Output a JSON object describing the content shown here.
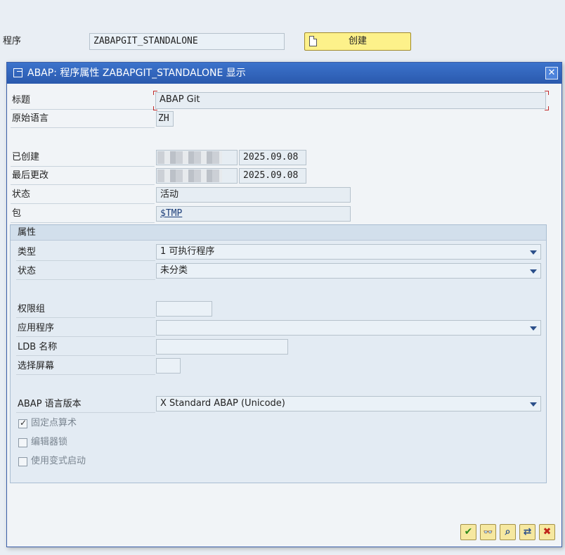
{
  "background": {
    "program_label": "程序",
    "program_value": "ZABAPGIT_STANDALONE",
    "create_button": "创建"
  },
  "dialog": {
    "title": "ABAP: 程序属性 ZABAPGIT_STANDALONE 显示",
    "close_glyph": "✕",
    "fields": {
      "title_label": "标题",
      "title_value": "ABAP Git",
      "orig_lang_label": "原始语言",
      "orig_lang_value": "ZH",
      "created_label": "已创建",
      "created_date": "2025.09.08",
      "changed_label": "最后更改",
      "changed_date": "2025.09.08",
      "status_label": "状态",
      "status_value": "活动",
      "package_label": "包",
      "package_value": "$TMP"
    },
    "attributes": {
      "header": "属性",
      "type_label": "类型",
      "type_value": "1 可执行程序",
      "status_label": "状态",
      "status_value": "未分类",
      "authgroup_label": "权限组",
      "authgroup_value": "",
      "app_label": "应用程序",
      "app_value": "",
      "ldb_label": "LDB 名称",
      "ldb_value": "",
      "selscreen_label": "选择屏幕",
      "selscreen_value": "",
      "abap_version_label": "ABAP 语言版本",
      "abap_version_value": "X Standard ABAP (Unicode)",
      "fixed_point_label": "固定点算术",
      "fixed_point_checked": true,
      "editor_lock_label": "编辑器锁",
      "editor_lock_checked": false,
      "variant_start_label": "使用变式启动",
      "variant_start_checked": false
    },
    "toolbar": {
      "confirm_icon": "check-icon",
      "check_icon": "glasses-icon",
      "search_icon": "magnifier-icon",
      "transfer_icon": "transfer-icon",
      "cancel_icon": "cancel-icon"
    }
  }
}
